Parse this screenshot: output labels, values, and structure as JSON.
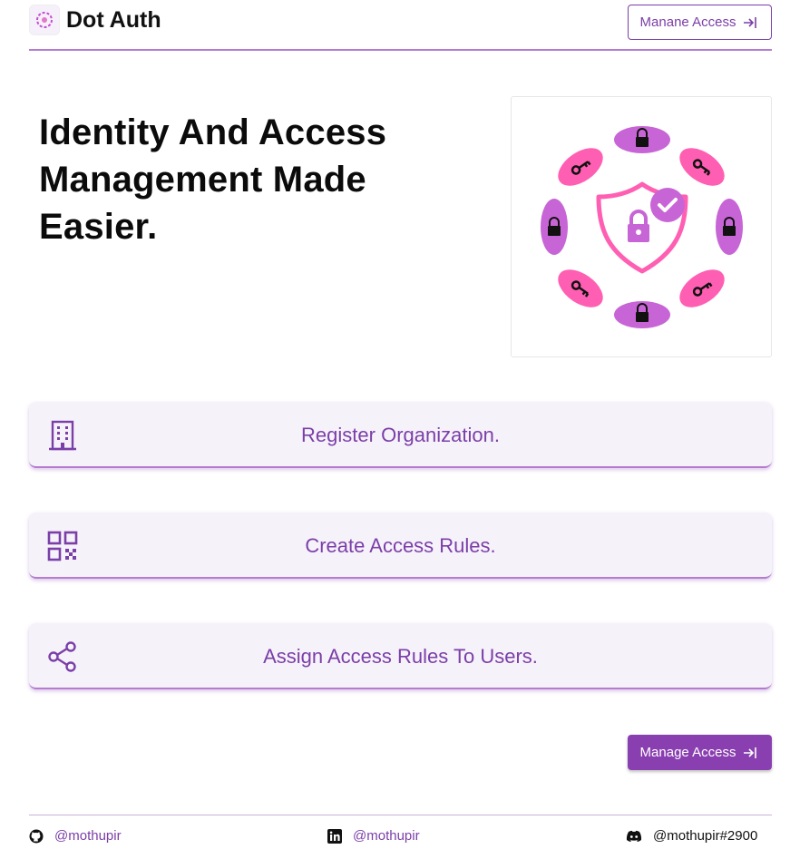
{
  "header": {
    "brand": "Dot Auth",
    "manage_button": "Manane Access"
  },
  "hero": {
    "title": "Identity And Access Management Made Easier."
  },
  "cards": [
    {
      "label": "Register Organization.",
      "icon": "building-icon"
    },
    {
      "label": "Create Access Rules.",
      "icon": "qr-code-icon"
    },
    {
      "label": "Assign Access Rules To Users.",
      "icon": "share-icon"
    }
  ],
  "cta": {
    "label": "Manage Access"
  },
  "footer": {
    "github": "@mothupir",
    "linkedin": "@mothupir",
    "discord": "@mothupir#2900"
  },
  "colors": {
    "accent": "#7b3fa8",
    "primary_button": "#8a3fb0",
    "card_bg": "#f6f2fa",
    "illustration_pink": "#ff5fb2",
    "illustration_purple": "#c865d6"
  }
}
